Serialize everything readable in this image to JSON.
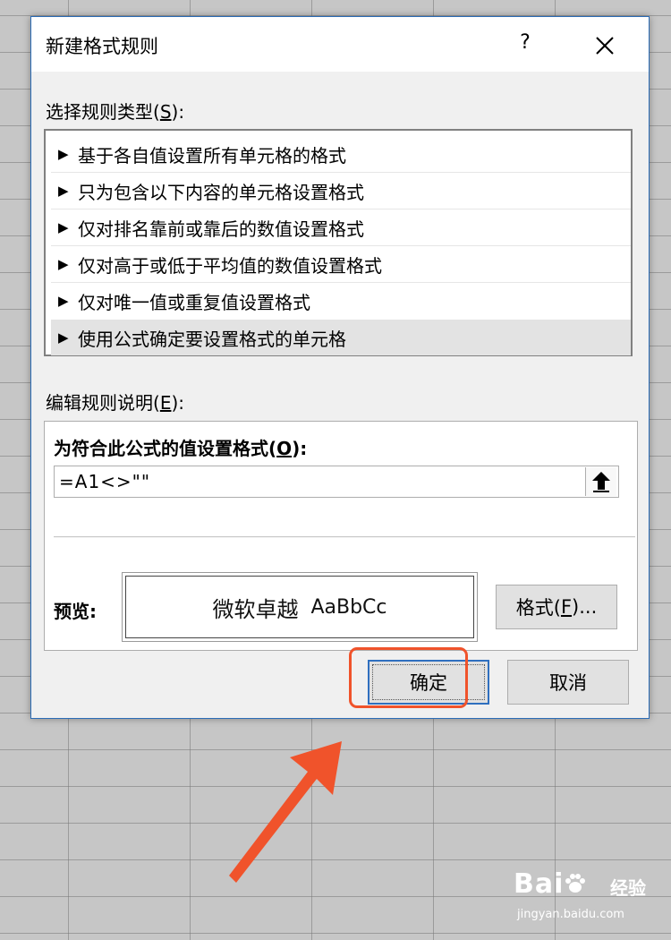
{
  "dialog": {
    "title": "新建格式规则",
    "help_label": "?",
    "rule_type_label_pre": "选择规则类型(",
    "rule_type_label_key": "S",
    "rule_type_label_post": "):",
    "rule_items": [
      "基于各自值设置所有单元格的格式",
      "只为包含以下内容的单元格设置格式",
      "仅对排名靠前或靠后的数值设置格式",
      "仅对高于或低于平均值的数值设置格式",
      "仅对唯一值或重复值设置格式",
      "使用公式确定要设置格式的单元格"
    ],
    "selected_rule_index": 5,
    "edit_label_pre": "编辑规则说明(",
    "edit_label_key": "E",
    "edit_label_post": "):",
    "formula_label_pre": "为符合此公式的值设置格式(",
    "formula_label_key": "O",
    "formula_label_post": "):",
    "formula_value": "=A1<>\"\"",
    "preview_label": "预览:",
    "preview_cjk": "微软卓越",
    "preview_latin": "AaBbCc",
    "format_button_pre": "格式(",
    "format_button_key": "F",
    "format_button_post": ")...",
    "ok_button": "确定",
    "cancel_button": "取消"
  },
  "watermark": {
    "logo_text": "Bai",
    "logo_suffix": "经验",
    "url": "jingyan.baidu.com"
  },
  "colors": {
    "accent_border": "#2b6cb6",
    "highlight": "#f0532b",
    "arrow": "#f0532b"
  }
}
